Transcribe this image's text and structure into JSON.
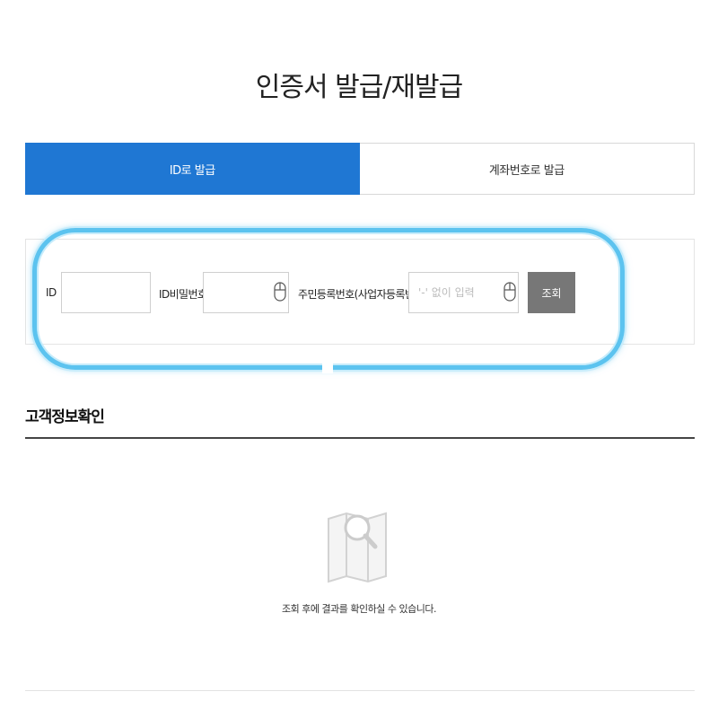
{
  "page": {
    "title": "인증서 발급/재발급"
  },
  "tabs": [
    {
      "label": "ID로 발급",
      "active": true
    },
    {
      "label": "계좌번호로 발급",
      "active": false
    }
  ],
  "search_form": {
    "id_label": "ID",
    "id_value": "",
    "password_label": "ID비밀번호",
    "password_value": "",
    "rrn_label": "주민등록번호(사업자등록번호)",
    "rrn_placeholder": "'-' 없이 입력",
    "search_button": "조회"
  },
  "result_section": {
    "title": "고객정보확인",
    "empty_message": "조회 후에 결과를 확인하실 수 있습니다.",
    "empty_icon": "map-search-icon"
  },
  "colors": {
    "accent": "#1f77d3",
    "button": "#777777",
    "highlight": "#5cc3ef"
  }
}
